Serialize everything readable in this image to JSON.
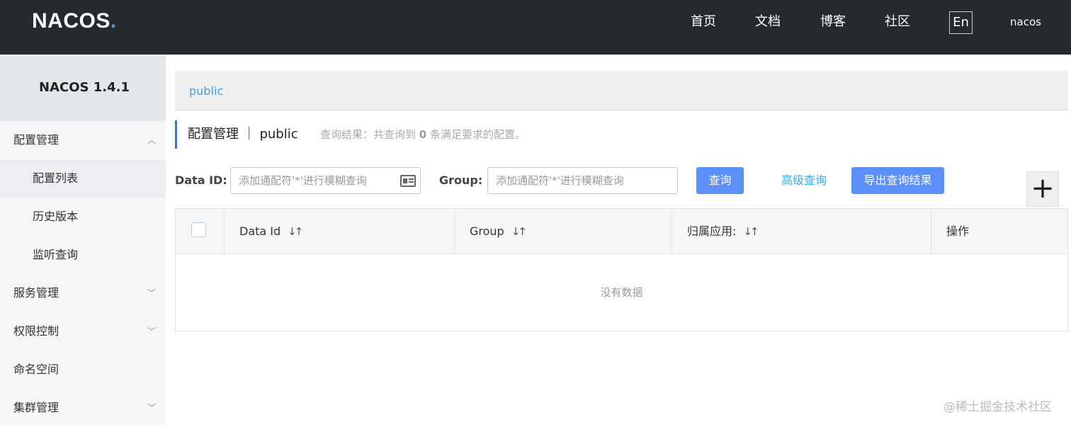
{
  "header": {
    "logo": {
      "part1": "NA",
      "part2": "COS",
      "dot": "."
    },
    "nav": {
      "home": "首页",
      "docs": "文档",
      "blog": "博客",
      "community": "社区"
    },
    "lang": "En",
    "user": "nacos"
  },
  "sidebar": {
    "brand": "NACOS 1.4.1",
    "items": [
      {
        "label": "配置管理",
        "icon": "chevron-up-icon"
      },
      {
        "label": "配置列表"
      },
      {
        "label": "历史版本"
      },
      {
        "label": "监听查询"
      },
      {
        "label": "服务管理",
        "icon": "chevron-down-icon"
      },
      {
        "label": "权限控制",
        "icon": "chevron-down-icon"
      },
      {
        "label": "命名空间"
      },
      {
        "label": "集群管理",
        "icon": "chevron-down-icon"
      }
    ]
  },
  "breadcrumb": {
    "namespace": "public"
  },
  "title": {
    "text": "配置管理 ｜ public",
    "query_prefix": "查询结果：共查询到",
    "query_count": "0",
    "query_suffix": "条满足要求的配置。"
  },
  "filters": {
    "data_id_label": "Data ID:",
    "data_id_placeholder": "添加通配符'*'进行模糊查询",
    "group_label": "Group:",
    "group_placeholder": "添加通配符'*'进行模糊查询",
    "query_button": "查询",
    "advanced_link": "高级查询",
    "export_button": "导出查询结果",
    "add_button": "+"
  },
  "table": {
    "columns": [
      "Data Id",
      "Group",
      "归属应用:",
      "操作"
    ],
    "empty_text": "没有数据"
  },
  "watermark": "@稀土掘金技术社区",
  "colors": {
    "topbar": "#252a2f",
    "primary": "#5b8ff9",
    "accent": "#3d9ee9",
    "sidebar": "#f4f6f8"
  }
}
